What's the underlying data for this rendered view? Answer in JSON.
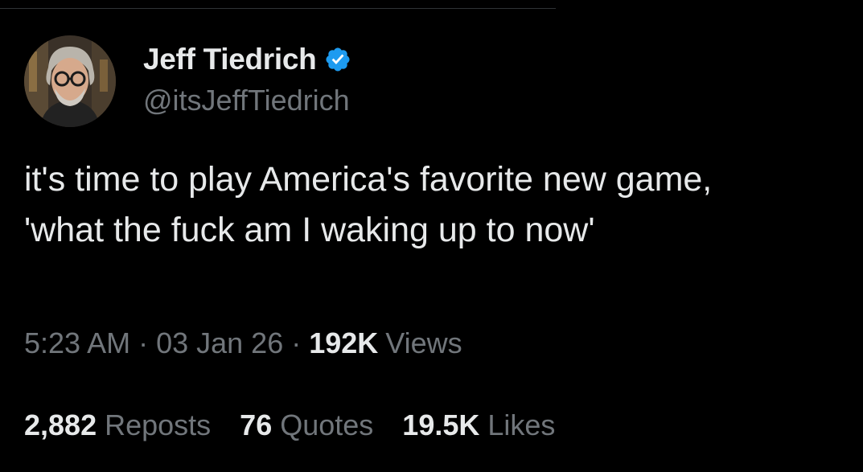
{
  "author": {
    "display_name": "Jeff Tiedrich",
    "handle": "@itsJeffTiedrich",
    "verified": true,
    "verified_color": "#1d9bf0"
  },
  "tweet": {
    "text": "it's time to play America's favorite new game, 'what the fuck am I waking up to now'"
  },
  "meta": {
    "time": "5:23 AM",
    "date": "03 Jan 26",
    "separator": "·",
    "views_count": "192K",
    "views_label": "Views"
  },
  "stats": {
    "reposts_count": "2,882",
    "reposts_label": "Reposts",
    "quotes_count": "76",
    "quotes_label": "Quotes",
    "likes_count": "19.5K",
    "likes_label": "Likes"
  },
  "colors": {
    "background": "#000000",
    "primary_text": "#e7e9ea",
    "secondary_text": "#71767b"
  },
  "icons": {
    "verified": "verified-badge-icon"
  }
}
